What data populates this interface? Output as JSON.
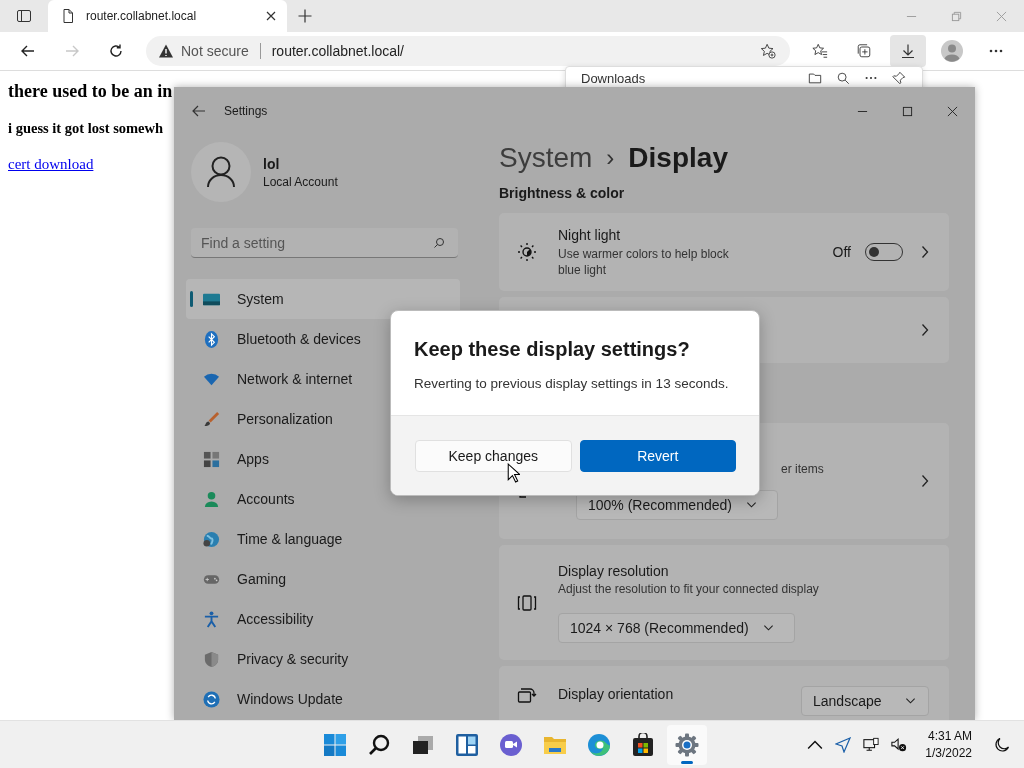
{
  "browser": {
    "tab": {
      "title": "router.collabnet.local",
      "selected": true
    },
    "nav_buttons": [
      {
        "kind": "back",
        "disabled": false
      },
      {
        "kind": "forward",
        "disabled": true
      },
      {
        "kind": "refresh",
        "disabled": false
      }
    ],
    "address": {
      "security": "Not secure",
      "url": "router.collabnet.local/"
    },
    "toolbar_buttons": [
      {
        "kind": "favorites",
        "selected": false
      },
      {
        "kind": "collections",
        "selected": false
      },
      {
        "kind": "downloads",
        "selected": true
      },
      {
        "kind": "profile",
        "selected": false
      },
      {
        "kind": "more",
        "selected": false
      }
    ]
  },
  "page": {
    "heading": "there used to be an in",
    "subheading": "i guess it got lost somewh",
    "link": "cert download"
  },
  "downloads_panel": {
    "title": "Downloads"
  },
  "settings": {
    "title": "Settings",
    "user": {
      "name": "lol",
      "account": "Local Account"
    },
    "search": {
      "placeholder": "Find a setting"
    },
    "nav": [
      {
        "label": "System",
        "selected": true
      },
      {
        "label": "Bluetooth & devices",
        "selected": false
      },
      {
        "label": "Network & internet",
        "selected": false
      },
      {
        "label": "Personalization",
        "selected": false
      },
      {
        "label": "Apps",
        "selected": false
      },
      {
        "label": "Accounts",
        "selected": false
      },
      {
        "label": "Time & language",
        "selected": false
      },
      {
        "label": "Gaming",
        "selected": false
      },
      {
        "label": "Accessibility",
        "selected": false
      },
      {
        "label": "Privacy & security",
        "selected": false
      },
      {
        "label": "Windows Update",
        "selected": false
      }
    ],
    "breadcrumb": {
      "parent": "System",
      "separator": "›",
      "current": "Display"
    },
    "section": "Brightness & color",
    "cards": [
      {
        "kind": "toggle",
        "title": "Night light",
        "description": "Use warmer colors to help block blue light",
        "value": "Off",
        "on": false
      },
      {
        "kind": "link"
      },
      {
        "kind": "scale",
        "description": "er items",
        "value": "100% (Recommended)"
      },
      {
        "kind": "dropdown",
        "title": "Display resolution",
        "description": "Adjust the resolution to fit your connected display",
        "value": "1024 × 768 (Recommended)"
      },
      {
        "kind": "inline",
        "title": "Display orientation",
        "value": "Landscape"
      }
    ]
  },
  "dialog": {
    "title": "Keep these display settings?",
    "message": "Reverting to previous display settings in 13 seconds.",
    "buttons": [
      {
        "label": "Keep changes",
        "kind": "secondary"
      },
      {
        "label": "Revert",
        "kind": "primary"
      }
    ]
  },
  "taskbar": {
    "apps": [
      {
        "selected": false
      },
      {
        "selected": false
      },
      {
        "selected": false
      },
      {
        "selected": false
      },
      {
        "selected": false
      },
      {
        "selected": false
      },
      {
        "selected": false
      },
      {
        "selected": false
      },
      {
        "selected": true
      }
    ],
    "time": "4:31 AM",
    "date": "1/3/2022"
  }
}
